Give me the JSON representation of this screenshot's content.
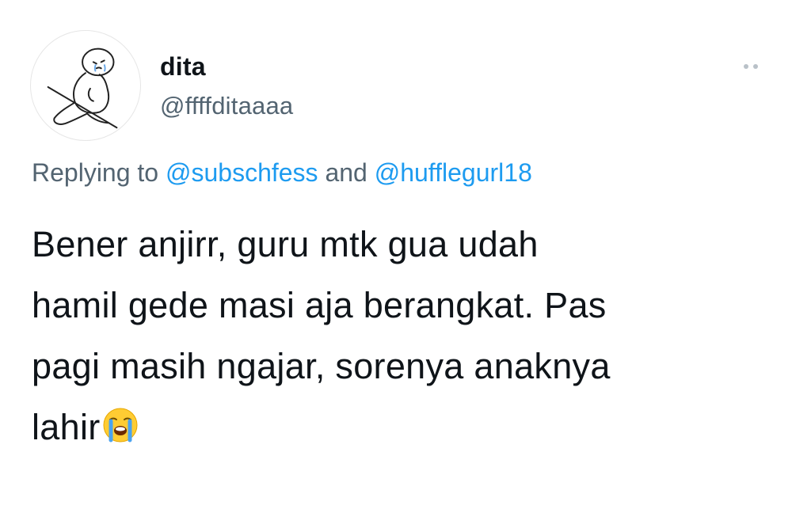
{
  "author": {
    "display_name": "dita",
    "handle": "@ffffditaaaa",
    "avatar_icon": "crying-doodle-avatar"
  },
  "more_icon": "more-options-icon",
  "reply_context": {
    "prefix": "Replying to ",
    "mention_1": "@subschfess",
    "joiner": " and ",
    "mention_2": "@hufflegurl18"
  },
  "tweet": {
    "lines": [
      "Bener anjirr, guru mtk gua udah",
      "hamil gede masi aja berangkat. Pas",
      "pagi masih ngajar, sorenya anaknya",
      "lahir"
    ],
    "emoji": "loudly-crying-face-emoji"
  },
  "colors": {
    "text": "#0f1419",
    "secondary": "#536471",
    "link": "#1d9bf0"
  }
}
